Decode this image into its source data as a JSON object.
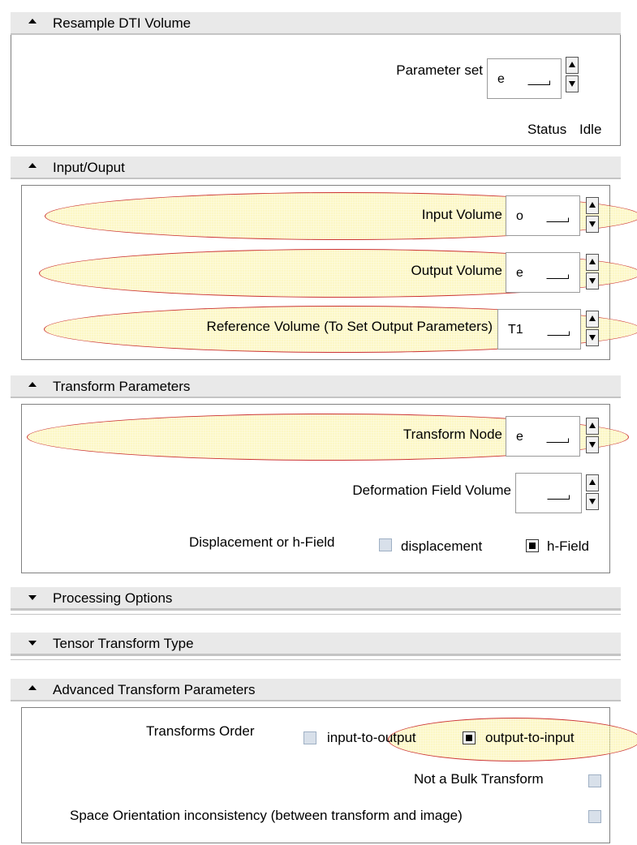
{
  "main_header": {
    "title": "Resample DTI Volume"
  },
  "parameter_set": {
    "label": "Parameter set",
    "value": "e"
  },
  "status": {
    "label": "Status",
    "value": "Idle"
  },
  "sections": {
    "input_output": {
      "title": "Input/Ouput",
      "input_volume": {
        "label": "Input Volume",
        "value": "o"
      },
      "output_volume": {
        "label": "Output Volume",
        "value": "e"
      },
      "reference_volume": {
        "label": "Reference Volume (To Set Output Parameters)",
        "value": "T1"
      }
    },
    "transform_parameters": {
      "title": "Transform Parameters",
      "transform_node": {
        "label": "Transform Node",
        "value": "e"
      },
      "deformation_field": {
        "label": "Deformation Field Volume",
        "value": ""
      },
      "displacement": {
        "label": "Displacement or h-Field",
        "options": [
          {
            "label": "displacement",
            "checked": false
          },
          {
            "label": "h-Field",
            "checked": true
          }
        ]
      }
    },
    "processing_options": {
      "title": "Processing Options"
    },
    "tensor_transform_type": {
      "title": "Tensor Transform Type"
    },
    "advanced_transform_parameters": {
      "title": "Advanced Transform Parameters",
      "transforms_order": {
        "label": "Transforms Order",
        "options": [
          {
            "label": "input-to-output",
            "checked": false
          },
          {
            "label": "output-to-input",
            "checked": true
          }
        ]
      },
      "not_bulk": {
        "label": "Not a Bulk Transform",
        "checked": false
      },
      "space_orientation": {
        "label": "Space Orientation inconsistency (between transform and image)",
        "checked": false
      }
    }
  },
  "colors": {
    "highlight_fill": "#faf096",
    "highlight_border": "#cc3333",
    "header_bg": "#e9e9e9"
  }
}
